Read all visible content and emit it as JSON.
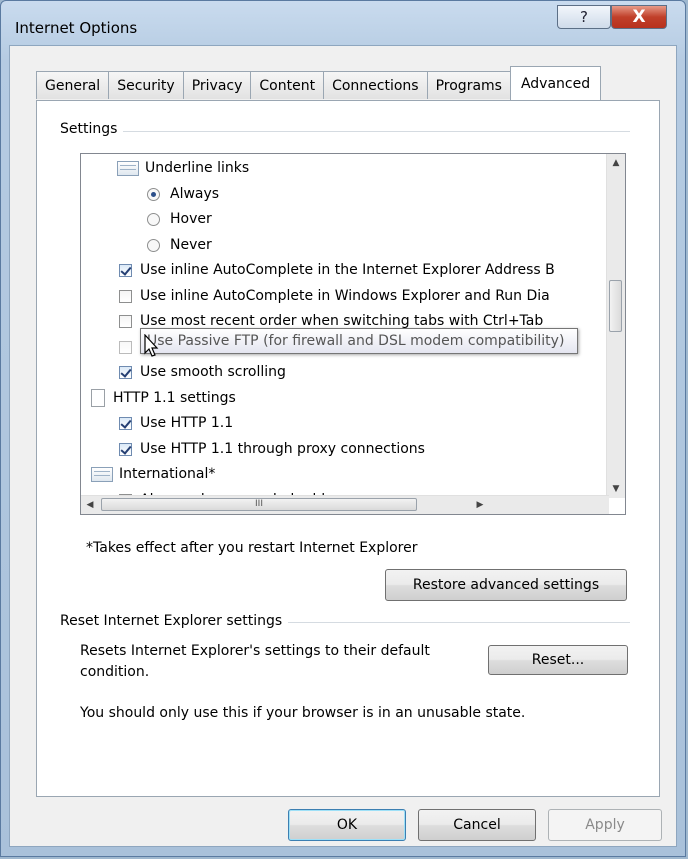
{
  "window": {
    "title": "Internet Options",
    "help_glyph": "?",
    "close_glyph": "X"
  },
  "tabs": [
    "General",
    "Security",
    "Privacy",
    "Content",
    "Connections",
    "Programs",
    "Advanced"
  ],
  "settings": {
    "group_label": "Settings",
    "items": [
      {
        "kind": "folder",
        "label": "Underline links"
      },
      {
        "kind": "radio",
        "label": "Always",
        "selected": true
      },
      {
        "kind": "radio",
        "label": "Hover",
        "selected": false
      },
      {
        "kind": "radio",
        "label": "Never",
        "selected": false
      },
      {
        "kind": "check",
        "label": "Use inline AutoComplete in the Internet Explorer Address B",
        "checked": true
      },
      {
        "kind": "check",
        "label": "Use inline AutoComplete in Windows Explorer and Run Dia",
        "checked": false
      },
      {
        "kind": "check",
        "label": "Use most recent order when switching tabs with Ctrl+Tab",
        "checked": false
      },
      {
        "kind": "check",
        "label": "Use Passive FTP (for firewall and DSL modem compatibility)",
        "checked": false
      },
      {
        "kind": "check",
        "label": "Use smooth scrolling",
        "checked": true
      },
      {
        "kind": "page",
        "label": "HTTP 1.1 settings"
      },
      {
        "kind": "check",
        "label": "Use HTTP 1.1",
        "checked": true
      },
      {
        "kind": "check",
        "label": "Use HTTP 1.1 through proxy connections",
        "checked": true
      },
      {
        "kind": "folder",
        "label": "International*"
      },
      {
        "kind": "check",
        "label": "Always show encoded addresses",
        "checked": false
      }
    ],
    "tooltip": "Use Passive FTP (for firewall and DSL modem compatibility)",
    "scroll_grip": "III",
    "note": "*Takes effect after you restart Internet Explorer",
    "restore_button": "Restore advanced settings"
  },
  "reset": {
    "group_label": "Reset Internet Explorer settings",
    "description_line1": "Resets Internet Explorer's settings to their default",
    "description_line2": "condition.",
    "warning": "You should only use this if your browser is in an unusable state.",
    "reset_button": "Reset..."
  },
  "footer": {
    "ok": "OK",
    "cancel": "Cancel",
    "apply": "Apply"
  }
}
